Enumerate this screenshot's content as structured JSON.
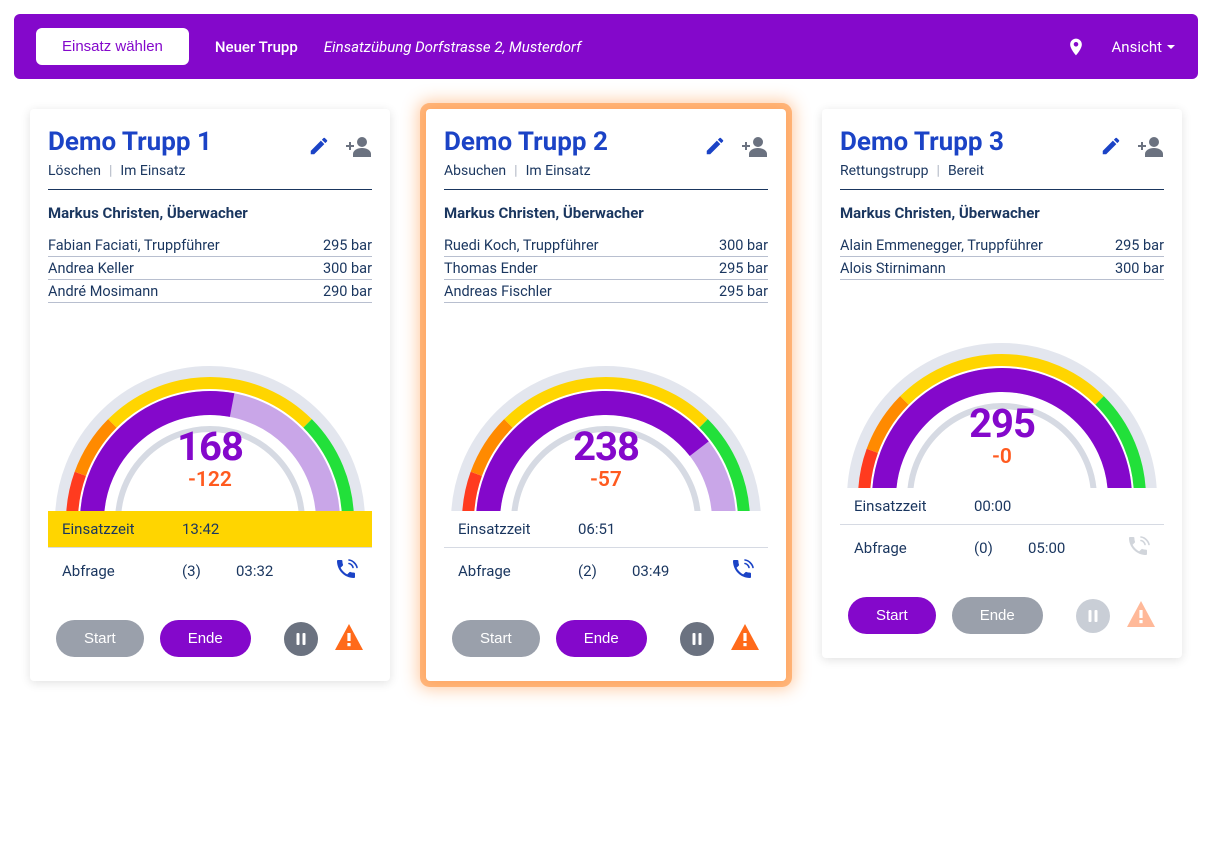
{
  "nav": {
    "choose_mission": "Einsatz wählen",
    "new_team": "Neuer Trupp",
    "mission_text": "Einsatzübung Dorfstrasse 2, Musterdorf",
    "view_label": "Ansicht"
  },
  "labels": {
    "einsatzzeit": "Einsatzzeit",
    "abfrage": "Abfrage",
    "start": "Start",
    "ende": "Ende",
    "bar_unit": "bar"
  },
  "colors": {
    "accent": "#8408cb",
    "warn": "#ffd500",
    "alert": "#ff6a1a",
    "link": "#1b43c6"
  },
  "cards": [
    {
      "title": "Demo Trupp 1",
      "role": "Löschen",
      "status": "Im Einsatz",
      "supervisor": "Markus Christen, Überwacher",
      "members": [
        {
          "name": "Fabian Faciati, Truppführer",
          "pressure": "295 bar"
        },
        {
          "name": "Andrea Keller",
          "pressure": "300 bar"
        },
        {
          "name": "André Mosimann",
          "pressure": "290 bar"
        }
      ],
      "gauge": {
        "value": "168",
        "delta": "-122",
        "frac": 0.56
      },
      "einsatzzeit": "13:42",
      "einsatzzeit_warn": true,
      "abfrage_count": "(3)",
      "abfrage_time": "03:32",
      "phone_enabled": true,
      "start_enabled": false,
      "ende_enabled": true,
      "pause_light": false,
      "warn_muted": false,
      "highlight": false
    },
    {
      "title": "Demo Trupp 2",
      "role": "Absuchen",
      "status": "Im Einsatz",
      "supervisor": "Markus Christen, Überwacher",
      "members": [
        {
          "name": "Ruedi Koch, Truppführer",
          "pressure": "300 bar"
        },
        {
          "name": "Thomas Ender",
          "pressure": "295 bar"
        },
        {
          "name": "Andreas Fischler",
          "pressure": "295 bar"
        }
      ],
      "gauge": {
        "value": "238",
        "delta": "-57",
        "frac": 0.79
      },
      "einsatzzeit": "06:51",
      "einsatzzeit_warn": false,
      "abfrage_count": "(2)",
      "abfrage_time": "03:49",
      "phone_enabled": true,
      "start_enabled": false,
      "ende_enabled": true,
      "pause_light": false,
      "warn_muted": false,
      "highlight": true
    },
    {
      "title": "Demo Trupp 3",
      "role": "Rettungstrupp",
      "status": "Bereit",
      "supervisor": "Markus Christen, Überwacher",
      "members": [
        {
          "name": "Alain Emmenegger, Truppführer",
          "pressure": "295 bar"
        },
        {
          "name": "Alois Stirnimann",
          "pressure": "300 bar"
        }
      ],
      "gauge": {
        "value": "295",
        "delta": "-0",
        "frac": 0.98
      },
      "einsatzzeit": "00:00",
      "einsatzzeit_warn": false,
      "abfrage_count": "(0)",
      "abfrage_time": "05:00",
      "phone_enabled": false,
      "start_enabled": true,
      "ende_enabled": false,
      "pause_light": true,
      "warn_muted": true,
      "highlight": false
    }
  ]
}
